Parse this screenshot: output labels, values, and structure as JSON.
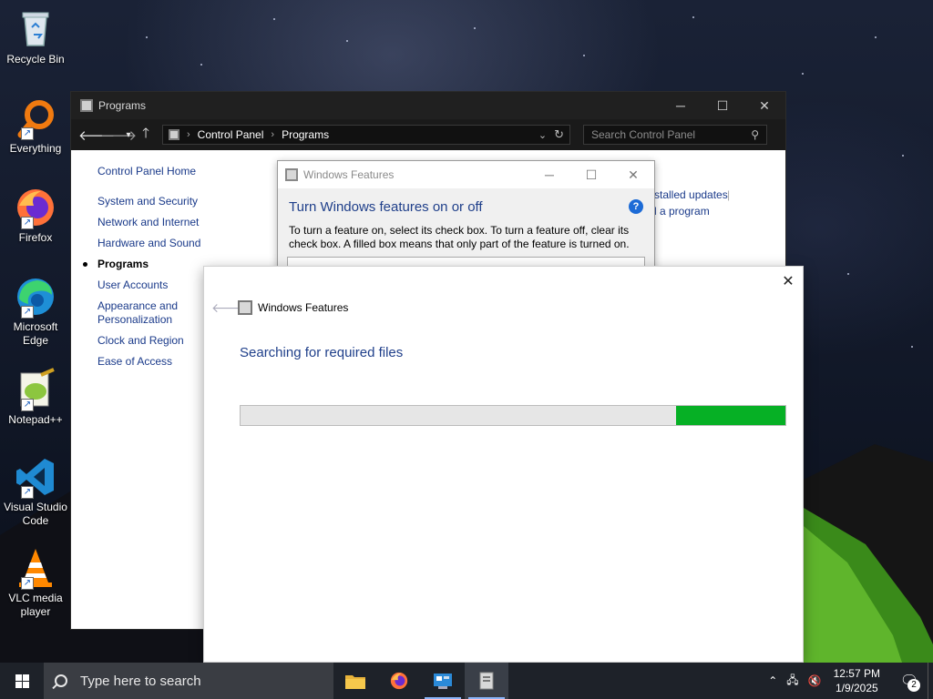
{
  "desktop_icons": [
    {
      "label": "Recycle Bin",
      "icon": "recycle-bin-icon"
    },
    {
      "label": "Everything",
      "icon": "everything-search-icon"
    },
    {
      "label": "Firefox",
      "icon": "firefox-icon"
    },
    {
      "label": "Microsoft Edge",
      "icon": "edge-icon"
    },
    {
      "label": "Notepad++",
      "icon": "notepadpp-icon"
    },
    {
      "label": "Visual Studio Code",
      "icon": "vscode-icon"
    },
    {
      "label": "VLC media player",
      "icon": "vlc-icon"
    }
  ],
  "control_panel": {
    "title": "Programs",
    "breadcrumb": [
      "Control Panel",
      "Programs"
    ],
    "search_placeholder": "Search Control Panel",
    "sidebar": {
      "home": "Control Panel Home",
      "items": [
        "System and Security",
        "Network and Internet",
        "Hardware and Sound",
        "Programs",
        "User Accounts",
        "Appearance and Personalization",
        "Clock and Region",
        "Ease of Access"
      ],
      "active": "Programs"
    },
    "links": [
      "stalled updates",
      "l a program"
    ]
  },
  "features_dialog": {
    "title": "Windows Features",
    "heading": "Turn Windows features on or off",
    "description": "To turn a feature on, select its check box. To turn a feature off, clear its check box. A filled box means that only part of the feature is turned on."
  },
  "progress_dialog": {
    "title": "Windows Features",
    "status": "Searching for required files",
    "progress": {
      "start": 0.8,
      "end": 1.0
    }
  },
  "taskbar": {
    "search_placeholder": "Type here to search",
    "apps": [
      "file-explorer-icon",
      "firefox-icon",
      "control-panel-icon",
      "windows-features-icon"
    ],
    "time": "12:57 PM",
    "date": "1/9/2025",
    "notification_count": "2"
  },
  "colors": {
    "progress_fill": "#06b025",
    "link_blue": "#1a3a8a",
    "heading_blue": "#1f3f8a"
  }
}
